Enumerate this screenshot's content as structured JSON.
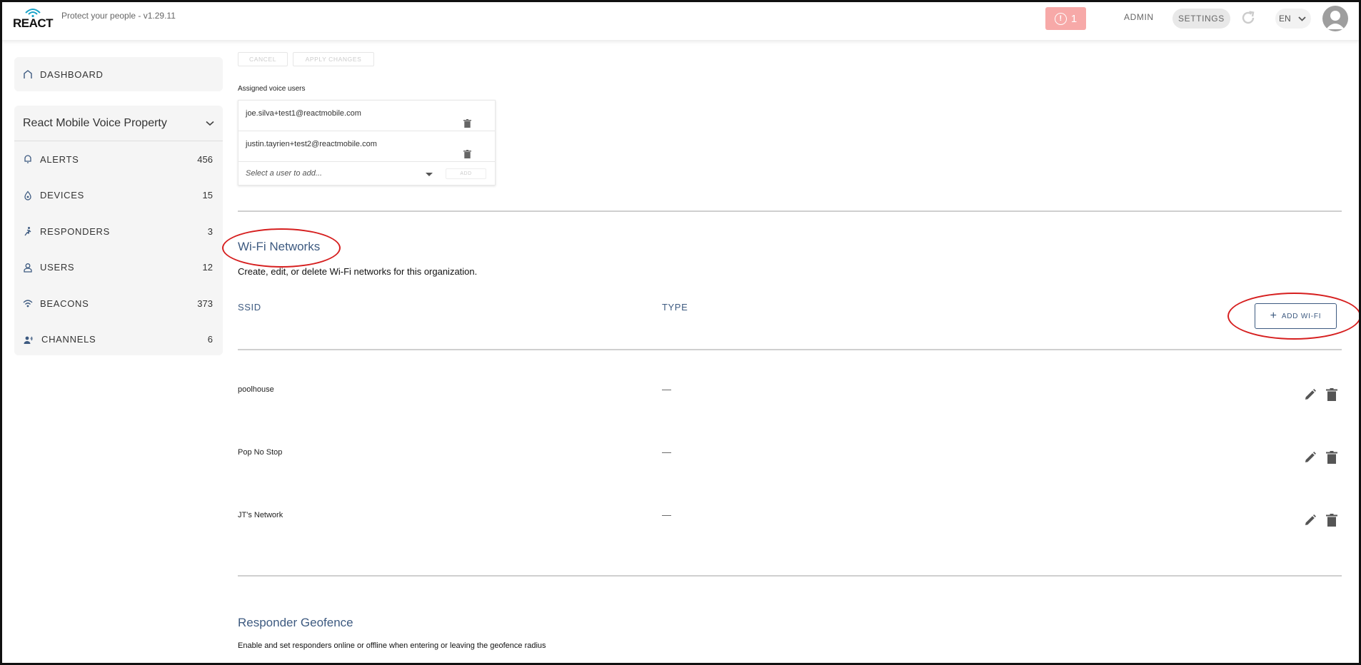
{
  "header": {
    "brand": "REACT",
    "tagline": "Protect your people - v1.29.11",
    "alert_count": "1",
    "admin_label": "ADMIN",
    "settings_label": "SETTINGS",
    "language": "EN"
  },
  "sidebar": {
    "dashboard": "DASHBOARD",
    "property": "React Mobile Voice Property",
    "items": [
      {
        "label": "ALERTS",
        "count": "456",
        "icon": "bell-icon"
      },
      {
        "label": "DEVICES",
        "count": "15",
        "icon": "device-icon"
      },
      {
        "label": "RESPONDERS",
        "count": "3",
        "icon": "runner-icon"
      },
      {
        "label": "USERS",
        "count": "12",
        "icon": "user-icon"
      },
      {
        "label": "BEACONS",
        "count": "373",
        "icon": "beacon-icon"
      },
      {
        "label": "CHANNELS",
        "count": "6",
        "icon": "channel-icon"
      }
    ]
  },
  "main": {
    "cancel": "CANCEL",
    "apply": "APPLY CHANGES",
    "assigned_title": "Assigned voice users",
    "voice_users": [
      "joe.silva+test1@reactmobile.com",
      "justin.tayrien+test2@reactmobile.com"
    ],
    "select_placeholder": "Select a user to add...",
    "add": "ADD",
    "wifi": {
      "title": "Wi-Fi Networks",
      "description": "Create, edit, or delete Wi-Fi networks for this organization.",
      "col_ssid": "SSID",
      "col_type": "TYPE",
      "add_button": "ADD WI-FI",
      "rows": [
        {
          "ssid": "poolhouse",
          "type": "—"
        },
        {
          "ssid": "Pop No Stop",
          "type": "—"
        },
        {
          "ssid": "JT's Network",
          "type": "—"
        }
      ]
    },
    "geofence": {
      "title": "Responder Geofence",
      "description": "Enable and set responders online or offline when entering or leaving the geofence radius"
    }
  },
  "colors": {
    "accent": "#3d5a80",
    "alert": "#f7a9a8",
    "annotation": "#d61f1f"
  }
}
